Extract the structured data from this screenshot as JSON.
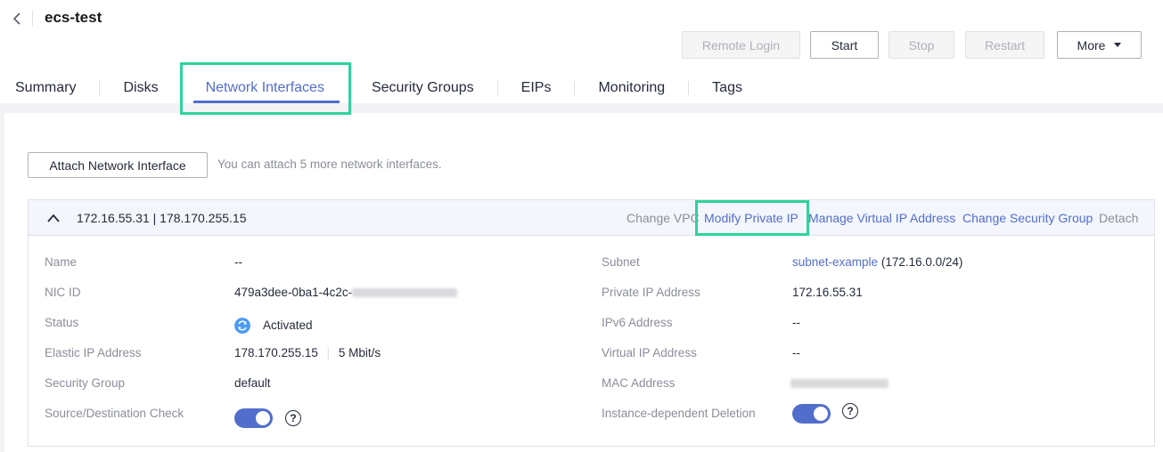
{
  "header": {
    "title": "ecs-test",
    "buttons": {
      "remote_login": "Remote Login",
      "start": "Start",
      "stop": "Stop",
      "restart": "Restart",
      "more": "More"
    }
  },
  "tabs": [
    {
      "label": "Summary"
    },
    {
      "label": "Disks"
    },
    {
      "label": "Network Interfaces",
      "active": true
    },
    {
      "label": "Security Groups"
    },
    {
      "label": "EIPs"
    },
    {
      "label": "Monitoring"
    },
    {
      "label": "Tags"
    }
  ],
  "toolbar": {
    "attach_label": "Attach Network Interface",
    "hint": "You can attach 5 more network interfaces."
  },
  "nic": {
    "title": "172.16.55.31 | 178.170.255.15",
    "actions": {
      "change_vpc": "Change VPC",
      "modify_private_ip": "Modify Private IP",
      "manage_virtual_ip": "Manage Virtual IP Address",
      "change_security_group": "Change Security Group",
      "detach": "Detach"
    },
    "left_fields": {
      "name_label": "Name",
      "name_value": "--",
      "nic_id_label": "NIC ID",
      "nic_id_value": "479a3dee-0ba1-4c2c-",
      "status_label": "Status",
      "status_value": "Activated",
      "eip_label": "Elastic IP Address",
      "eip_value": "178.170.255.15",
      "eip_bandwidth": "5 Mbit/s",
      "sg_label": "Security Group",
      "sg_value": "default",
      "sdc_label": "Source/Destination Check",
      "sdc_enabled": true
    },
    "right_fields": {
      "subnet_label": "Subnet",
      "subnet_link": "subnet-example",
      "subnet_cidr": "(172.16.0.0/24)",
      "private_ip_label": "Private IP Address",
      "private_ip_value": "172.16.55.31",
      "ipv6_label": "IPv6 Address",
      "ipv6_value": "--",
      "vip_label": "Virtual IP Address",
      "vip_value": "--",
      "mac_label": "MAC Address",
      "idd_label": "Instance-dependent Deletion",
      "idd_enabled": true
    }
  },
  "colors": {
    "accent": "#526ecc",
    "highlight": "#2ed39c",
    "status": "#4c9bf2"
  },
  "icons": [
    "back-icon",
    "chevron-up-icon",
    "status-activated-icon",
    "help-icon",
    "caret-down-icon"
  ]
}
